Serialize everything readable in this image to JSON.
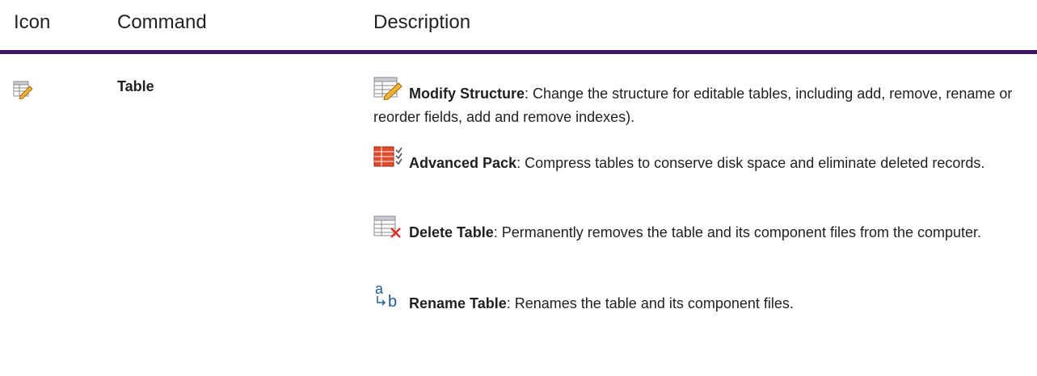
{
  "headers": {
    "icon": "Icon",
    "command": "Command",
    "description": "Description"
  },
  "row": {
    "command": "Table",
    "icon_name": "table-edit-icon",
    "items": [
      {
        "icon": "table-edit-icon",
        "title": "Modify Structure",
        "text": ": Change the structure for editable tables, including add, remove, rename or reorder fields, add and remove indexes)."
      },
      {
        "icon": "advanced-pack-icon",
        "title": "Advanced Pack",
        "text": ": Compress tables to conserve disk space and eliminate deleted records."
      },
      {
        "icon": "delete-table-icon",
        "title": "Delete Table",
        "text": ": Permanently removes the table and its component files from the computer."
      },
      {
        "icon": "rename-table-icon",
        "title": "Rename Table",
        "text": ": Renames the table and its component files."
      }
    ]
  },
  "colors": {
    "rule": "#3b1466",
    "text": "#231f20",
    "rename_icon": "#1f5a96",
    "delete_x": "#d9322b"
  }
}
